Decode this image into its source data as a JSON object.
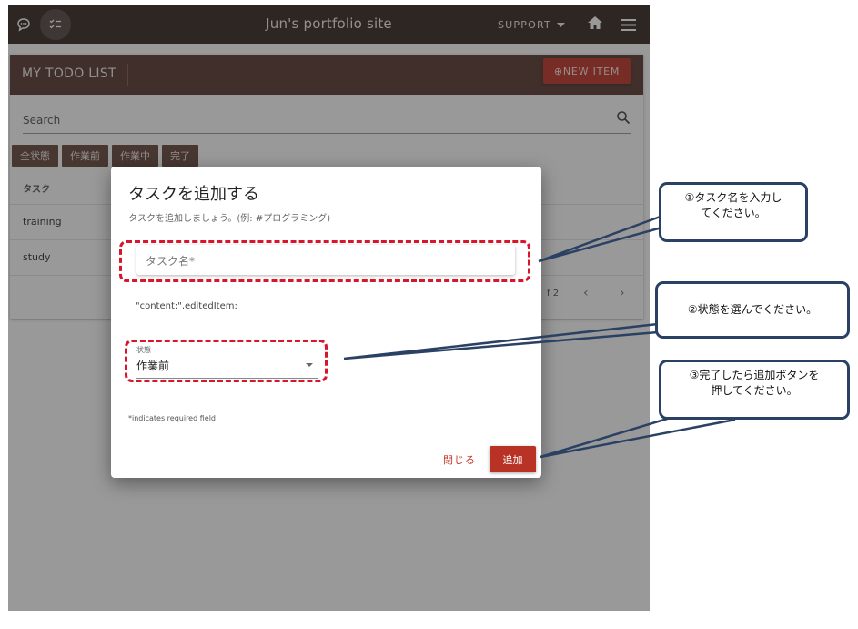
{
  "appbar": {
    "title": "Jun's portfolio site",
    "support_label": "SUPPORT",
    "icons": [
      "chat-icon",
      "checklist-icon",
      "chevron-down-icon",
      "home-icon",
      "menu-icon"
    ]
  },
  "card": {
    "title": "MY TODO LIST",
    "new_item_label": "⊕NEW ITEM",
    "search_placeholder": "Search",
    "filters": [
      "全状態",
      "作業前",
      "作業中",
      "完了"
    ],
    "table_header": "タスク",
    "rows": [
      "training",
      "study"
    ],
    "pagination": "f 2",
    "prev_glyph": "‹",
    "next_glyph": "›"
  },
  "dialog": {
    "title": "タスクを追加する",
    "subtitle": "タスクを追加しましょう。(例: #プログラミング)",
    "name_placeholder": "タスク名*",
    "debug_text": "\"content:\",editedItem:",
    "status_label": "状態",
    "status_value": "作業前",
    "required_note": "*indicates required field",
    "close_label": "閉じる",
    "add_label": "追加"
  },
  "annotations": {
    "callout1_line1": "①タスク名を入力し",
    "callout1_line2": "てください。",
    "callout2": "②状態を選んでください。",
    "callout3_line1": "③完了したら追加ボタンを",
    "callout3_line2": "押してください。"
  },
  "colors": {
    "appbar": "#3a2b26",
    "toolbar": "#5b3c33",
    "accent": "#c0392b",
    "dashed_highlight": "#d8152b",
    "callout_border": "#2b4164"
  }
}
